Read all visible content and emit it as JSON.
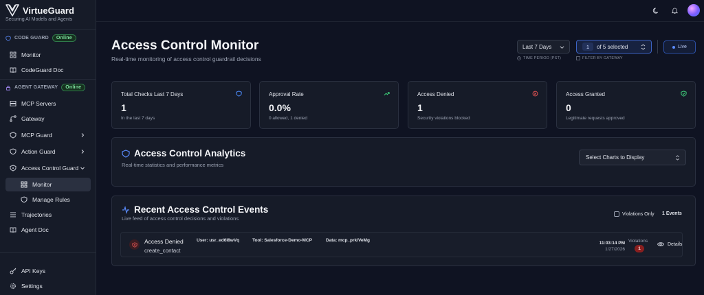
{
  "brand": {
    "name": "VirtueGuard",
    "tagline": "Securing AI Models and Agents"
  },
  "sidebar": {
    "code_guard": {
      "label": "CODE GUARD",
      "status": "Online"
    },
    "code_items": [
      {
        "label": "Monitor",
        "icon": "grid-icon"
      },
      {
        "label": "CodeGuard Doc",
        "icon": "book-icon"
      }
    ],
    "agent_gateway": {
      "label": "AGENT GATEWAY",
      "status": "Online"
    },
    "agent_items": [
      {
        "label": "MCP Servers",
        "icon": "server-icon"
      },
      {
        "label": "Gateway",
        "icon": "route-icon"
      },
      {
        "label": "MCP Guard",
        "icon": "shield-icon"
      },
      {
        "label": "Action Guard",
        "icon": "shield-icon"
      },
      {
        "label": "Access Control Guard",
        "icon": "shield-lock-icon"
      },
      {
        "label": "Monitor",
        "icon": "grid-icon"
      },
      {
        "label": "Manage Rules",
        "icon": "shield-icon"
      },
      {
        "label": "Trajectories",
        "icon": "list-icon"
      },
      {
        "label": "Agent Doc",
        "icon": "book-icon"
      }
    ],
    "bottom_items": [
      {
        "label": "API Keys",
        "icon": "key-icon"
      },
      {
        "label": "Settings",
        "icon": "gear-icon"
      }
    ]
  },
  "header": {
    "title": "Access Control Monitor",
    "subtitle": "Real-time monitoring of access control guardrail decisions",
    "time_period": {
      "value": "Last 7 Days",
      "label": "TIME PERIOD (PST)"
    },
    "gateway_filter": {
      "count": "1",
      "value": "of 5 selected",
      "label": "FILTER BY GATEWAY"
    },
    "live_label": "Live"
  },
  "stats": [
    {
      "title": "Total Checks Last 7 Days",
      "value": "1",
      "sub": "In the last 7 days",
      "icon": "shield-icon",
      "color": "#4d8dff"
    },
    {
      "title": "Approval Rate",
      "value": "0.0%",
      "sub": "0 allowed, 1 denied",
      "icon": "trending-up-icon",
      "color": "#3ecf7a"
    },
    {
      "title": "Access Denied",
      "value": "1",
      "sub": "Security violations blocked",
      "icon": "x-circle-icon",
      "color": "#e05252"
    },
    {
      "title": "Access Granted",
      "value": "0",
      "sub": "Legitimate requests approved",
      "icon": "shield-check-icon",
      "color": "#3ecf7a"
    }
  ],
  "analytics": {
    "title": "Access Control Analytics",
    "subtitle": "Real-time statistics and performance metrics",
    "select_placeholder": "Select Charts to Display"
  },
  "events": {
    "title": "Recent Access Control Events",
    "subtitle": "Live feed of access control decisions and violations",
    "violations_only_label": "Violations Only",
    "count_label": "1 Events",
    "rows": [
      {
        "status": "Access Denied",
        "user": "User: usr_ed6I8wVq",
        "tool": "Tool: Salesforce-Demo-MCP",
        "data": "Data: mcp_prklVeMg",
        "action": "create_contact",
        "time": "11:03:14 PM",
        "date": "1/27/2026",
        "violations_label": "Violations",
        "violations": "1",
        "details_label": "Details"
      }
    ]
  }
}
